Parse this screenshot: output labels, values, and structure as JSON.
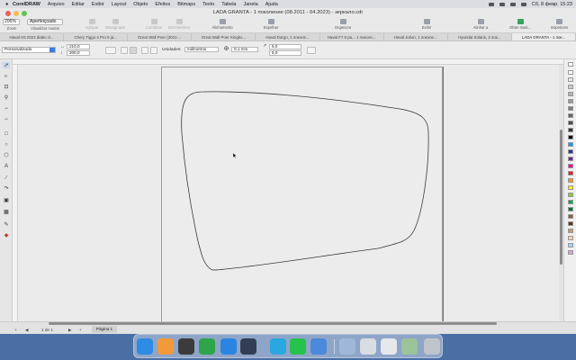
{
  "menubar": {
    "app": "CorelDRAW",
    "items": [
      "Arquivo",
      "Editar",
      "Exibir",
      "Layout",
      "Objeto",
      "Efeitos",
      "Bitmaps",
      "Texto",
      "Tabela",
      "Janela",
      "Ajuda"
    ],
    "clock": "Сб, 8 февр.  15:23"
  },
  "window": {
    "title": "LADA GRANTA - 1 поколение (08.2011 - 04.2023) - зеркало.cdr"
  },
  "toolbar": {
    "zoom_value": "206%",
    "view_mode": "Aperfeiçoado",
    "items": [
      {
        "label": "Zoom"
      },
      {
        "label": "Visualizar modos"
      },
      {
        "label": "Agrupar"
      },
      {
        "label": "Desagrupar"
      },
      {
        "label": "Combinar"
      },
      {
        "label": "Desmembrar"
      },
      {
        "label": "Alinhamento"
      },
      {
        "label": "Espelhar"
      },
      {
        "label": "Organizar"
      },
      {
        "label": "Exibir"
      },
      {
        "label": "Alinhar a"
      },
      {
        "label": "Obter mais..."
      },
      {
        "label": "Inspetores"
      }
    ]
  },
  "tabs": [
    {
      "label": "Haval H3 2022 diabo cl..."
    },
    {
      "label": "Chery Tiggo 4 Pro 6 ja..."
    },
    {
      "label": "Great Wall Poer (2021-..."
    },
    {
      "label": "Great Wall Poer Kingko..."
    },
    {
      "label": "Haval Dargo, 1 поколе..."
    },
    {
      "label": "Haval F7 5 ра... 1 поколе..."
    },
    {
      "label": "Haval Jolion, 1 поколе..."
    },
    {
      "label": "Hyundai Solaris, 2 пок..."
    },
    {
      "label": "LADA GRANTA - 1 пок..."
    }
  ],
  "propbar": {
    "preset": "Personalizado",
    "width": "210,0",
    "height": "200,0",
    "units_label": "Unidades:",
    "units_value": "milímetros",
    "nudge": "0,1 mm",
    "dup_x": "5,0",
    "dup_y": "5,0"
  },
  "status": {
    "page_of": "1  de  1",
    "page_tab": "Página 1"
  },
  "palette_colors": [
    "#ffffff",
    "#e6e6e6",
    "#cccccc",
    "#b3b3b3",
    "#999999",
    "#808080",
    "#666666",
    "#4d4d4d",
    "#333333",
    "#000000",
    "#00a0e9",
    "#2e3192",
    "#662d91",
    "#ec008c",
    "#ed1c24",
    "#f7941d",
    "#fff200",
    "#8dc63f",
    "#00a651",
    "#007236",
    "#8b5e3c",
    "#603913",
    "#c49a6c",
    "#f5d0a9",
    "#a0d8ef",
    "#d4a5d6"
  ],
  "dock_icons": [
    {
      "name": "finder-icon",
      "color": "#2e8be6"
    },
    {
      "name": "launchpad-icon",
      "color": "#f29a3a"
    },
    {
      "name": "calculator-icon",
      "color": "#3b3b3b"
    },
    {
      "name": "corel-icon",
      "color": "#2fa54a"
    },
    {
      "name": "safari-icon",
      "color": "#2a85e2"
    },
    {
      "name": "quicktime-icon",
      "color": "#333e55"
    },
    {
      "name": "telegram-icon",
      "color": "#2aa6e0"
    },
    {
      "name": "whatsapp-icon",
      "color": "#27c24c"
    },
    {
      "name": "folder-app-icon",
      "color": "#4a89dc"
    },
    {
      "name": "preview-icon",
      "color": "#9fb8d9"
    },
    {
      "name": "photos-icon",
      "color": "#d8dce3"
    },
    {
      "name": "documents-icon",
      "color": "#e6e8ec"
    },
    {
      "name": "notes-icon",
      "color": "#9bc49a"
    },
    {
      "name": "trash-icon",
      "color": "#bfc4cb"
    }
  ]
}
